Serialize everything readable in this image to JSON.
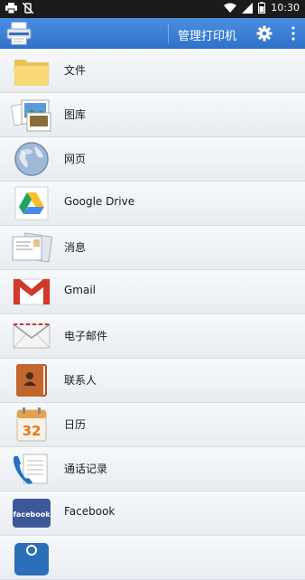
{
  "status_bar": {
    "time": "10:30",
    "icons": [
      "print-icon",
      "vibrate-off-icon",
      "wifi-icon",
      "signal-icon",
      "battery-icon"
    ]
  },
  "app_bar": {
    "title": "管理打印机",
    "icons": [
      "printer-app-logo",
      "gear-icon",
      "overflow-menu-icon"
    ]
  },
  "menu": {
    "items": [
      {
        "label": "文件",
        "icon": "folder-icon"
      },
      {
        "label": "图库",
        "icon": "gallery-icon"
      },
      {
        "label": "网页",
        "icon": "globe-icon"
      },
      {
        "label": "Google Drive",
        "icon": "google-drive-icon"
      },
      {
        "label": "消息",
        "icon": "messages-icon"
      },
      {
        "label": "Gmail",
        "icon": "gmail-icon"
      },
      {
        "label": "电子邮件",
        "icon": "email-icon"
      },
      {
        "label": "联系人",
        "icon": "contacts-icon"
      },
      {
        "label": "日历",
        "icon": "calendar-icon"
      },
      {
        "label": "通话记录",
        "icon": "call-log-icon"
      },
      {
        "label": "Facebook",
        "icon": "facebook-icon"
      }
    ]
  },
  "calendar_day": "32",
  "facebook_logo_text": "facebook",
  "colors": {
    "app_bar": "#3a7fd6",
    "status_bar": "#1b1b1b",
    "row_bg": "#eef1f5",
    "gmail_red": "#d0392b"
  }
}
